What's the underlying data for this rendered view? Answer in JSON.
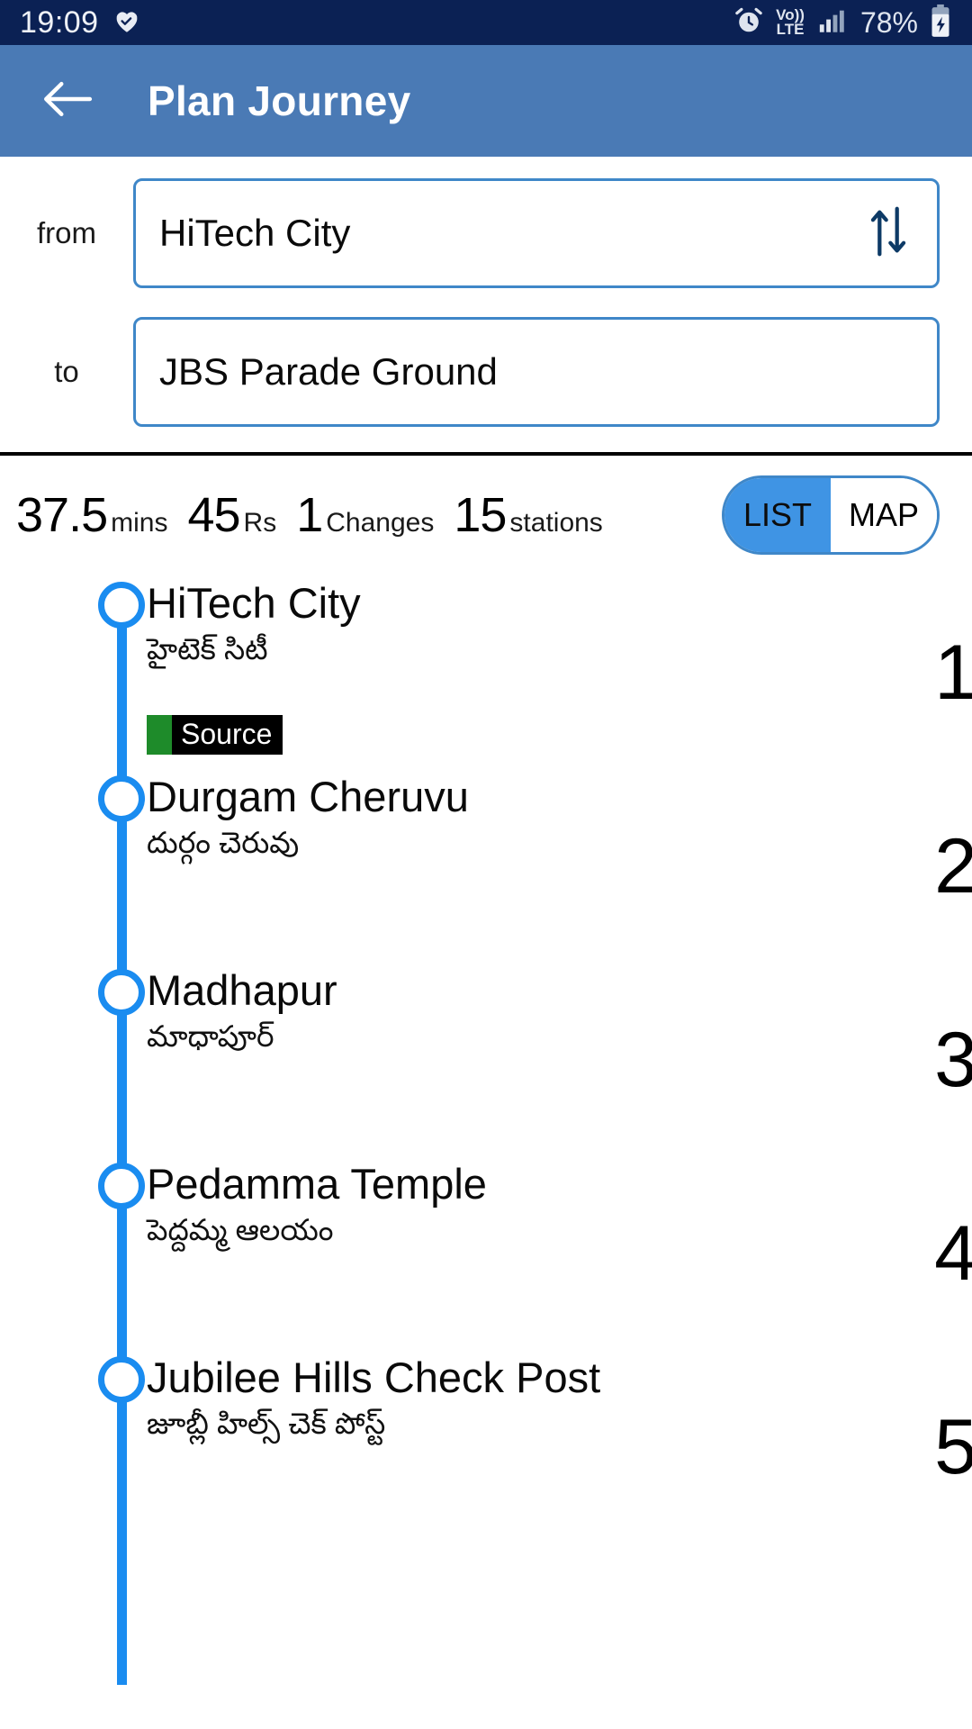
{
  "status_bar": {
    "time": "19:09",
    "heart_icon": "heart-icon",
    "alarm_icon": "alarm-clock-icon",
    "volte_line1": "Vo))",
    "volte_line2": "LTE",
    "signal_icon": "signal-bars-icon",
    "battery_percent": "78%",
    "battery_icon": "battery-charging-icon",
    "background": "#0b2154"
  },
  "app_bar": {
    "back_icon": "back-arrow-icon",
    "title": "Plan Journey",
    "background": "#4a7ab5"
  },
  "search": {
    "from_label": "from",
    "from_value": "HiTech City",
    "to_label": "to",
    "to_value": "JBS Parade Ground",
    "swap_icon": "swap-vertical-icon",
    "border_color": "#3f87c8"
  },
  "summary": {
    "stats": [
      {
        "value": "37.5",
        "unit": "mins"
      },
      {
        "value": "45",
        "unit": "Rs"
      },
      {
        "value": "1",
        "unit": "Changes"
      },
      {
        "value": "15",
        "unit": "stations"
      }
    ],
    "toggle": {
      "list_label": "LIST",
      "map_label": "MAP",
      "active": "LIST",
      "active_color": "#3f94e4"
    }
  },
  "route": {
    "line_color": "#1a8cf0",
    "stations": [
      {
        "name": "HiTech City",
        "local_name": "హైటెక్ సిటీ",
        "badge": {
          "text": "Source",
          "swatch_color": "#1e8b2a"
        },
        "seq": "1"
      },
      {
        "name": "Durgam Cheruvu",
        "local_name": "దుర్గం చెరువు",
        "badge": null,
        "seq": "2"
      },
      {
        "name": "Madhapur",
        "local_name": "మాధాపూర్",
        "badge": null,
        "seq": "3"
      },
      {
        "name": "Pedamma Temple",
        "local_name": "పెద్దమ్మ ఆలయం",
        "badge": null,
        "seq": "4"
      },
      {
        "name": "Jubilee Hills Check Post",
        "local_name": "జూబ్లీ హిల్స్ చెక్ పోస్ట్",
        "badge": null,
        "seq": "5"
      }
    ]
  }
}
